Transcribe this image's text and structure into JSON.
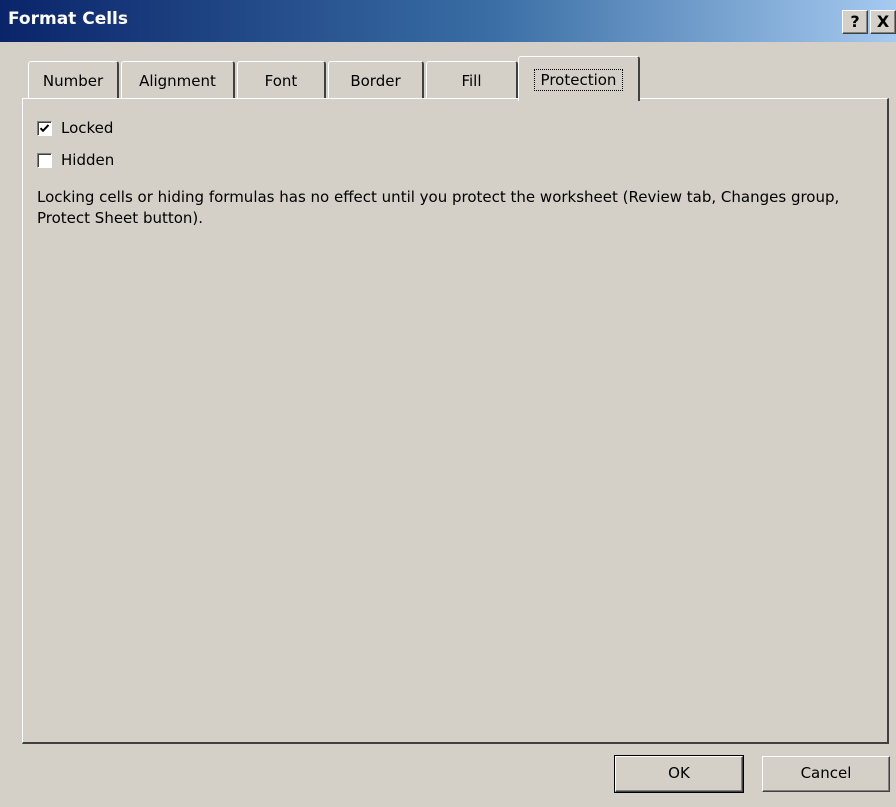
{
  "window": {
    "title": "Format Cells",
    "help_label": "?",
    "close_label": "X"
  },
  "tabs": [
    {
      "label": "Number"
    },
    {
      "label": "Alignment"
    },
    {
      "label": "Font"
    },
    {
      "label": "Border"
    },
    {
      "label": "Fill"
    },
    {
      "label": "Protection"
    }
  ],
  "active_tab": "Protection",
  "protection": {
    "locked": {
      "label": "Locked",
      "checked": true
    },
    "hidden": {
      "label": "Hidden",
      "checked": false
    },
    "info_text": "Locking cells or hiding formulas has no effect until you protect the worksheet (Review tab, Changes group, Protect Sheet button)."
  },
  "buttons": {
    "ok_label": "OK",
    "cancel_label": "Cancel"
  },
  "colors": {
    "titlebar_start": "#0a246a",
    "titlebar_end": "#a6caf0",
    "face": "#d4d0c8"
  }
}
